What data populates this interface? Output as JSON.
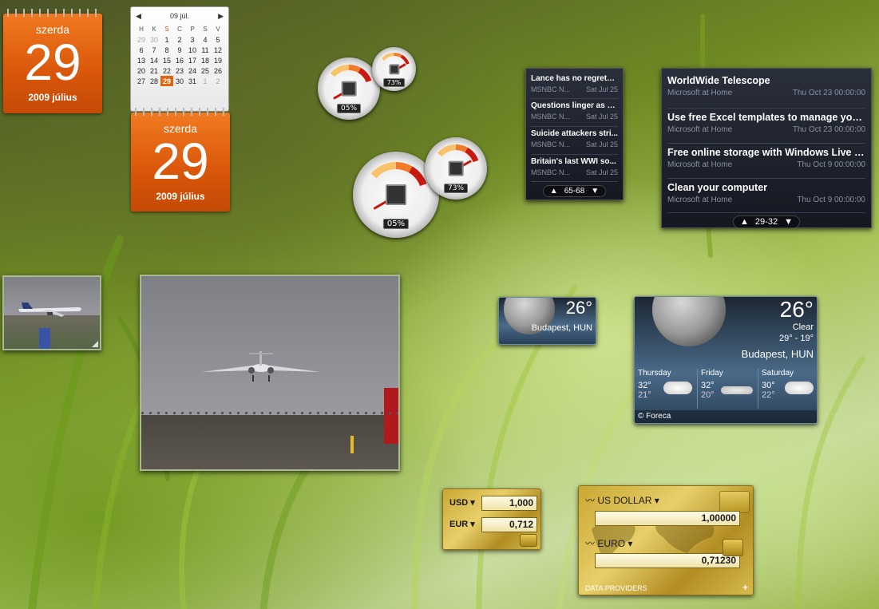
{
  "calendar": {
    "weekday": "szerda",
    "day": "29",
    "year_month": "2009 július",
    "month_title": "09 júl.",
    "headers": [
      "H",
      "K",
      "S",
      "C",
      "P",
      "S",
      "V"
    ],
    "weeks": [
      [
        "29",
        "30",
        "1",
        "2",
        "3",
        "4",
        "5"
      ],
      [
        "6",
        "7",
        "8",
        "9",
        "10",
        "11",
        "12"
      ],
      [
        "13",
        "14",
        "15",
        "16",
        "17",
        "18",
        "19"
      ],
      [
        "20",
        "21",
        "22",
        "23",
        "24",
        "25",
        "26"
      ],
      [
        "27",
        "28",
        "29",
        "30",
        "31",
        "1",
        "2"
      ]
    ]
  },
  "gauges": {
    "small": {
      "cpu": "05%",
      "mem": "73%"
    },
    "large": {
      "cpu": "05%",
      "mem": "73%"
    }
  },
  "news_small": {
    "items": [
      {
        "title": "Lance has no regrets ...",
        "source": "MSNBC N...",
        "date": "Sat Jul 25"
      },
      {
        "title": "Questions linger as P...",
        "source": "MSNBC N...",
        "date": "Sat Jul 25"
      },
      {
        "title": "Suicide attackers stri...",
        "source": "MSNBC N...",
        "date": "Sat Jul 25"
      },
      {
        "title": "Britain's last WWI so...",
        "source": "MSNBC N...",
        "date": "Sat Jul 25"
      }
    ],
    "pager": "65-68"
  },
  "news_large": {
    "items": [
      {
        "title": "WorldWide Telescope",
        "source": "Microsoft at Home",
        "date": "Thu Oct 23 00:00:00"
      },
      {
        "title": "Use free Excel templates to manage you...",
        "source": "Microsoft at Home",
        "date": "Thu Oct 23 00:00:00"
      },
      {
        "title": "Free online storage with Windows Live S...",
        "source": "Microsoft at Home",
        "date": "Thu Oct 9 00:00:00"
      },
      {
        "title": "Clean your computer",
        "source": "Microsoft at Home",
        "date": "Thu Oct 9 00:00:00"
      }
    ],
    "pager": "29-32"
  },
  "weather": {
    "temp": "26°",
    "location": "Budapest, HUN",
    "condition": "Clear",
    "range": "29° - 19°",
    "forecast": [
      {
        "day": "Thursday",
        "hi": "32°",
        "lo": "21°"
      },
      {
        "day": "Friday",
        "hi": "32°",
        "lo": "20°"
      },
      {
        "day": "Saturday",
        "hi": "30°",
        "lo": "22°"
      }
    ],
    "credit": "© Foreca"
  },
  "currency_small": {
    "from_code": "USD",
    "from_value": "1,000",
    "to_code": "EUR",
    "to_value": "0,712"
  },
  "currency_large": {
    "from_name": "US DOLLAR",
    "from_value": "1,00000",
    "to_name": "EURO",
    "to_value": "0,71230",
    "footer": "DATA PROVIDERS",
    "add": "+"
  },
  "colors": {
    "accent": "#e2640f",
    "gauge_red": "#c8160c"
  }
}
